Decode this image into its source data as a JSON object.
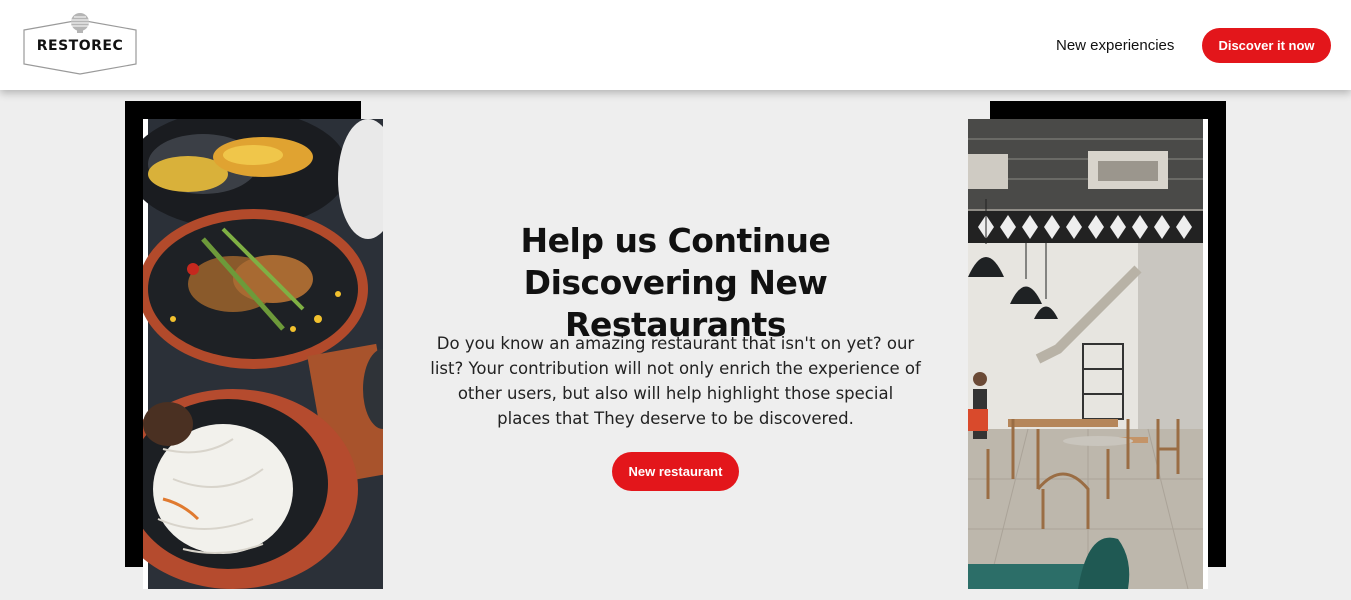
{
  "header": {
    "logo_text": "RESTOREC",
    "nav_link": "New experiencies",
    "cta_label": "Discover it now"
  },
  "hero": {
    "headline": "Help us Continue Discovering New Restaurants",
    "body": "Do you know an amazing restaurant that isn't on yet? our list? Your contribution will not only enrich the experience of other users, but also will help highlight those special places that They deserve to be discovered.",
    "cta_label": "New restaurant"
  },
  "images": {
    "left": "food-platter-photo",
    "right": "restaurant-interior-photo"
  },
  "colors": {
    "accent": "#e3161b",
    "background": "#eeeeee",
    "header_bg": "#ffffff",
    "frame": "#000000"
  }
}
